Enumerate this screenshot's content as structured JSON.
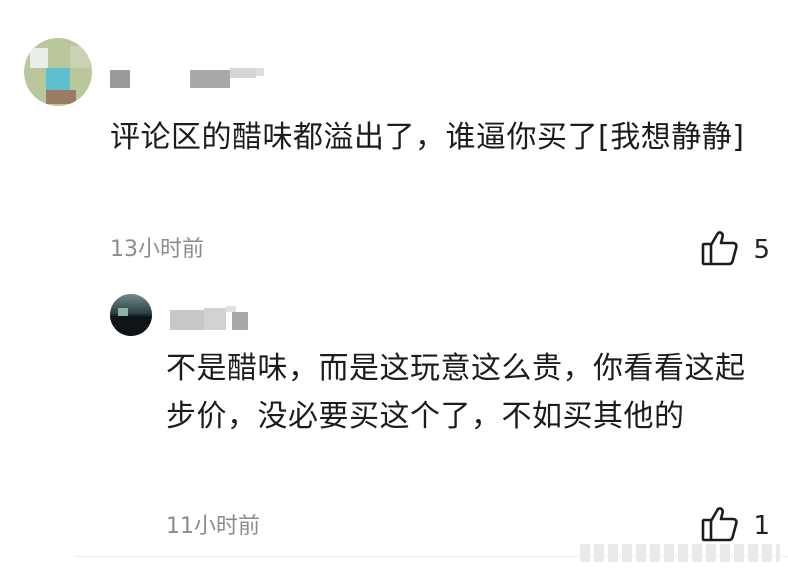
{
  "comment": {
    "text": "评论区的醋味都溢出了，谁逼你买了[我想静静]",
    "time": "13小时前",
    "likes": "5",
    "icon": "thumbs-up-icon"
  },
  "reply": {
    "text": "不是醋味，而是这玩意这么贵，你看看这起步价，没必要买这个了，不如买其他的",
    "time": "11小时前",
    "likes": "1",
    "icon": "thumbs-up-icon"
  }
}
